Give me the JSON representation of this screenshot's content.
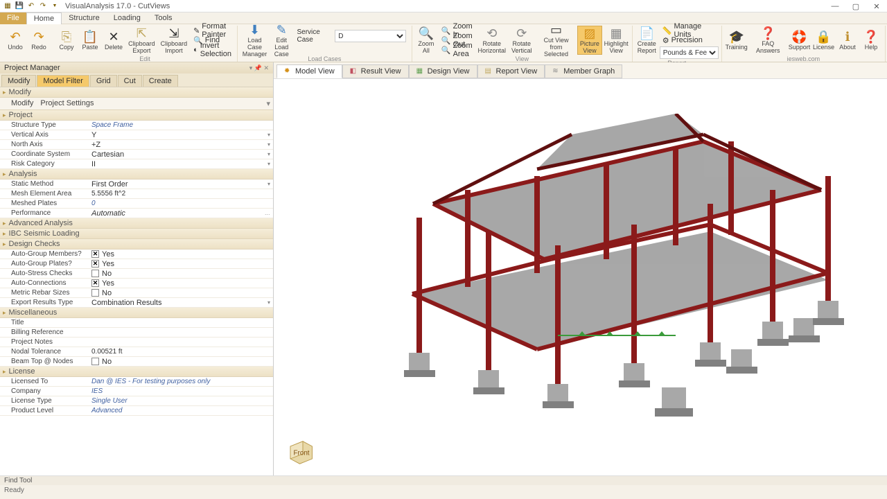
{
  "app": {
    "title": "VisualAnalysis 17.0 - CutViews"
  },
  "menu": {
    "file": "File",
    "tabs": [
      "Home",
      "Structure",
      "Loading",
      "Tools"
    ],
    "active": "Home"
  },
  "ribbon": {
    "undo": "Undo",
    "redo": "Redo",
    "copy": "Copy",
    "paste": "Paste",
    "delete": "Delete",
    "clip_export": "Clipboard Export",
    "clip_import": "Clipboard Import",
    "format_painter": "Format Painter",
    "find": "Find",
    "invert_sel": "Invert Selection",
    "edit_grp": "Edit",
    "lc_mgr": "Load Case Manager",
    "edit_lc": "Edit Load Case",
    "svc_case": "Service Case",
    "svc_val": "D",
    "lc_grp": "Load Cases",
    "zoom_all": "Zoom All",
    "zoom_in": "Zoom In",
    "zoom_out": "Zoom Out",
    "zoom_area": "Zoom Area",
    "rot_h": "Rotate Horizontal",
    "rot_v": "Rotate Vertical",
    "cut_sel": "Cut View from Selected",
    "pic_view": "Picture View",
    "hl_view": "Highlight View",
    "view_grp": "View",
    "create_rep": "Create Report",
    "mg_units": "Manage Units",
    "precision": "Precision",
    "units": "Pounds & Feet",
    "rep_grp": "Report",
    "training": "Training",
    "faq": "FAQ Answers",
    "support": "Support",
    "license": "License",
    "about": "About",
    "help": "Help",
    "web": "iesweb.com"
  },
  "pm": {
    "title": "Project Manager",
    "tabs": [
      "Modify",
      "Model Filter",
      "Grid",
      "Cut",
      "Create"
    ],
    "active_tab": "Model Filter",
    "modify_hdr": "Modify",
    "modify_link": "Modify",
    "settings_link": "Project Settings",
    "project_hdr": "Project",
    "struct_type_l": "Structure Type",
    "struct_type_v": "Space Frame",
    "vaxis_l": "Vertical Axis",
    "vaxis_v": "Y",
    "naxis_l": "North Axis",
    "naxis_v": "+Z",
    "coord_l": "Coordinate System",
    "coord_v": "Cartesian",
    "risk_l": "Risk Category",
    "risk_v": "II",
    "analysis_hdr": "Analysis",
    "static_l": "Static Method",
    "static_v": "First Order",
    "mesh_area_l": "Mesh Element Area",
    "mesh_area_v": "5.5556 ft^2",
    "meshed_l": "Meshed Plates",
    "meshed_v": "0",
    "perf_l": "Performance",
    "perf_v": "Automatic",
    "adv_hdr": "Advanced Analysis",
    "ibc_hdr": "IBC Seismic Loading",
    "design_hdr": "Design Checks",
    "ag_mem_l": "Auto-Group Members?",
    "yes": "Yes",
    "no": "No",
    "ag_plates_l": "Auto-Group Plates?",
    "as_checks_l": "Auto-Stress Checks",
    "ac_l": "Auto-Connections",
    "rebar_l": "Metric Rebar Sizes",
    "export_l": "Export Results Type",
    "export_v": "Combination Results",
    "misc_hdr": "Miscellaneous",
    "title_l": "Title",
    "bill_l": "Billing Reference",
    "notes_l": "Project Notes",
    "nodal_l": "Nodal Tolerance",
    "nodal_v": "0.00521 ft",
    "beam_l": "Beam Top @ Nodes",
    "lic_hdr": "License",
    "lic_to_l": "Licensed To",
    "lic_to_v": "Dan @ IES - For testing purposes only",
    "company_l": "Company",
    "company_v": "IES",
    "lic_type_l": "License Type",
    "lic_type_v": "Single User",
    "prod_l": "Product Level",
    "prod_v": "Advanced"
  },
  "views": {
    "model": "Model View",
    "result": "Result View",
    "design": "Design View",
    "report": "Report View",
    "member": "Member Graph"
  },
  "cube": "Front",
  "find": "Find Tool",
  "status": "Ready"
}
